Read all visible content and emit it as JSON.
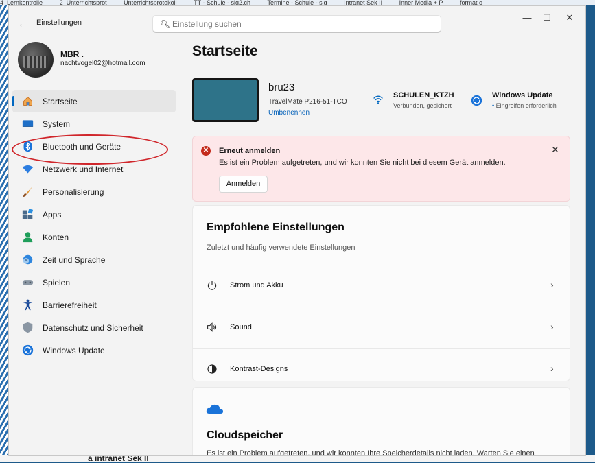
{
  "taskbar_tabs": [
    "4_Lernkontrolle",
    "2_Unterrichtsprot",
    "Unterrichtsprotokoll",
    "TT - Schule - sig2.ch",
    "Termine - Schule - sig",
    "Intranet Sek II",
    "Inner Media + P",
    "format c"
  ],
  "background_text": "a intranet Sek II",
  "app": {
    "title": "Einstellungen"
  },
  "search": {
    "placeholder": "Einstellung suchen"
  },
  "window_controls": {
    "minimize": "—",
    "maximize": "☐",
    "close": "✕"
  },
  "profile": {
    "name": "MBR .",
    "email": "nachtvogel02@hotmail.com"
  },
  "nav": [
    {
      "label": "Startseite",
      "icon": "home-icon",
      "active": true
    },
    {
      "label": "System",
      "icon": "monitor-icon"
    },
    {
      "label": "Bluetooth und Geräte",
      "icon": "bluetooth-icon"
    },
    {
      "label": "Netzwerk und Internet",
      "icon": "network-icon"
    },
    {
      "label": "Personalisierung",
      "icon": "brush-icon"
    },
    {
      "label": "Apps",
      "icon": "apps-icon"
    },
    {
      "label": "Konten",
      "icon": "account-icon"
    },
    {
      "label": "Zeit und Sprache",
      "icon": "globe-clock-icon"
    },
    {
      "label": "Spielen",
      "icon": "gamepad-icon"
    },
    {
      "label": "Barrierefreiheit",
      "icon": "accessibility-icon"
    },
    {
      "label": "Datenschutz und Sicherheit",
      "icon": "shield-icon"
    },
    {
      "label": "Windows Update",
      "icon": "update-icon"
    }
  ],
  "main": {
    "title": "Startseite",
    "device": {
      "name": "bru23",
      "model": "TravelMate P216-51-TCO",
      "rename": "Umbenennen"
    },
    "network": {
      "name": "SCHULEN_KTZH",
      "status": "Verbunden, gesichert"
    },
    "update": {
      "name": "Windows Update",
      "status": "Eingreifen erforderlich"
    },
    "alert": {
      "title": "Erneut anmelden",
      "message": "Es ist ein Problem aufgetreten, und wir konnten Sie nicht bei diesem Gerät anmelden.",
      "button": "Anmelden",
      "close": "✕"
    },
    "recommended": {
      "title": "Empfohlene Einstellungen",
      "subtitle": "Zuletzt und häufig verwendete Einstellungen",
      "rows": [
        {
          "label": "Strom und Akku",
          "icon": "power-icon"
        },
        {
          "label": "Sound",
          "icon": "speaker-icon"
        },
        {
          "label": "Kontrast-Designs",
          "icon": "contrast-icon"
        }
      ]
    },
    "cloud": {
      "title": "Cloudspeicher",
      "message": "Es ist ein Problem aufgetreten, und wir konnten Ihre Speicherdetails nicht laden. Warten Sie einen"
    }
  },
  "colors": {
    "accent": "#0067c0",
    "alert_bg": "#fde7e9",
    "annotation": "#d0262b"
  }
}
